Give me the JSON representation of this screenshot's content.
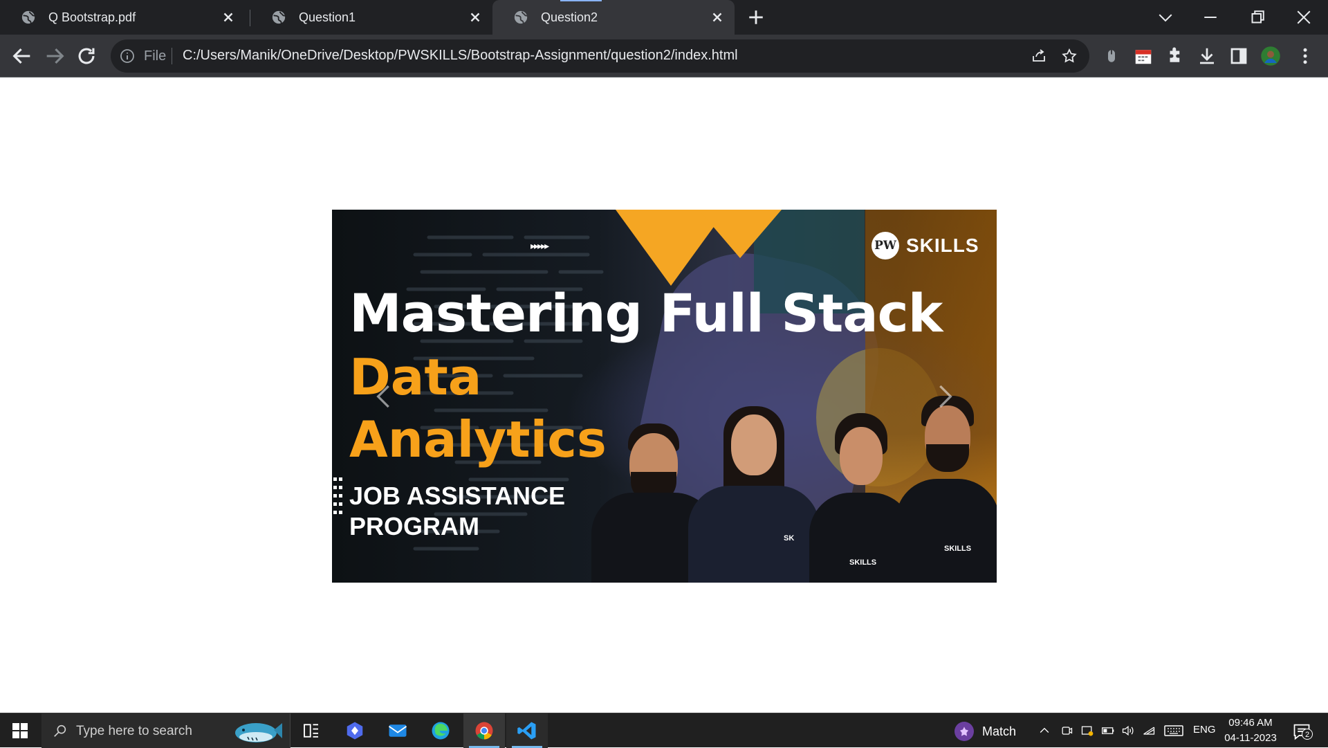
{
  "browser": {
    "tabs": [
      {
        "label": "Q Bootstrap.pdf",
        "active": false
      },
      {
        "label": "Question1",
        "active": false
      },
      {
        "label": "Question2",
        "active": true
      }
    ],
    "omnibox": {
      "scheme_label": "File",
      "url": "C:/Users/Manik/OneDrive/Desktop/PWSKILLS/Bootstrap-Assignment/question2/index.html"
    },
    "accent": "#8ab4f8"
  },
  "carousel": {
    "brand": "SKILLS",
    "brand_logo_text": "PW",
    "deco_arrows": "▸▸▸▸▸",
    "title": "Mastering Full Stack",
    "subtitle_line1": "Data",
    "subtitle_line2": "Analytics",
    "program_line1": "JOB ASSISTANCE",
    "program_line2": "PROGRAM",
    "badge_text": "SKILLS",
    "badge_text_short": "SK",
    "colors": {
      "accent": "#f7a11a",
      "text": "#ffffff"
    },
    "prev_icon": "chevron-left-icon",
    "next_icon": "chevron-right-icon"
  },
  "taskbar": {
    "search_placeholder": "Type here to search",
    "match_label": "Match",
    "language": "ENG",
    "time": "09:46 AM",
    "date": "04-11-2023",
    "notification_count": "2",
    "apps": [
      "task-view",
      "copilot",
      "mail",
      "edge",
      "chrome",
      "vscode"
    ]
  }
}
